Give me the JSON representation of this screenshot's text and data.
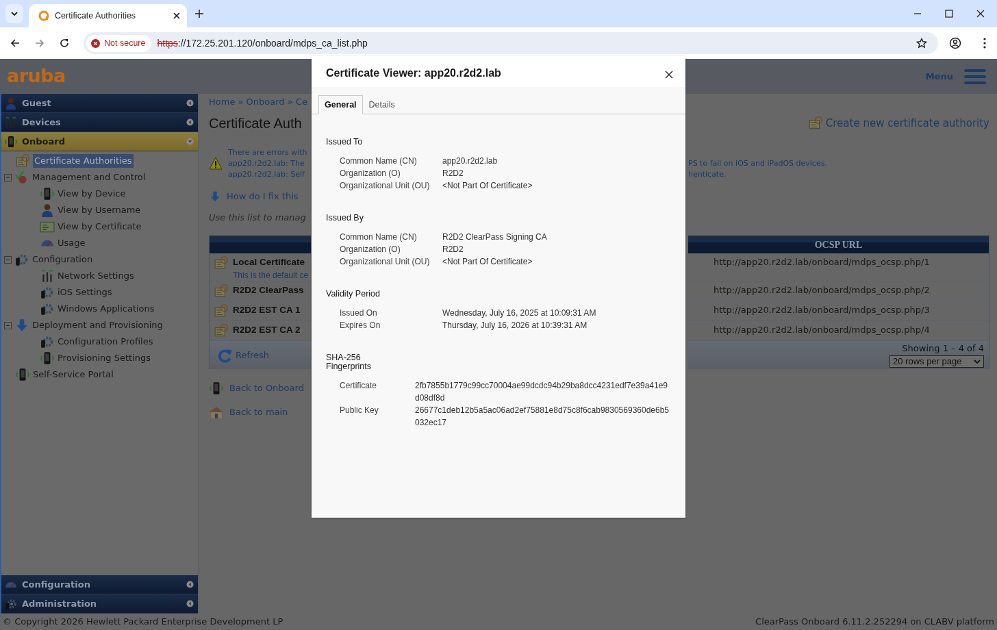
{
  "browser": {
    "tab_title": "Certificate Authorities",
    "security": "Not secure",
    "url_scheme": "https",
    "url_rest": "://172.25.201.120/onboard/mdps_ca_list.php"
  },
  "header": {
    "logo": "aruba",
    "menu_label": "Menu"
  },
  "sidebar": {
    "top_sections": [
      {
        "label": "Guest",
        "expanded": false
      },
      {
        "label": "Devices",
        "expanded": false
      },
      {
        "label": "Onboard",
        "expanded": true
      }
    ],
    "tree": [
      {
        "label": "Certificate Authorities",
        "selected": true
      },
      {
        "label": "Management and Control",
        "selected": false,
        "expanded": true,
        "children": [
          {
            "label": "View by Device",
            "selected": false
          },
          {
            "label": "View by Username",
            "selected": false
          },
          {
            "label": "View by Certificate",
            "selected": false
          },
          {
            "label": "Usage",
            "selected": false
          }
        ]
      },
      {
        "label": "Configuration",
        "selected": false,
        "expanded": true,
        "children": [
          {
            "label": "Network Settings",
            "selected": false
          },
          {
            "label": "iOS Settings",
            "selected": false
          },
          {
            "label": "Windows Applications",
            "selected": false
          }
        ]
      },
      {
        "label": "Deployment and Provisioning",
        "selected": false,
        "expanded": true,
        "children": [
          {
            "label": "Configuration Profiles",
            "selected": false
          },
          {
            "label": "Provisioning Settings",
            "selected": false
          }
        ]
      },
      {
        "label": "Self-Service Portal",
        "selected": false
      }
    ],
    "bottom_sections": [
      {
        "label": "Configuration",
        "expanded": false
      },
      {
        "label": "Administration",
        "expanded": false
      }
    ]
  },
  "content": {
    "breadcrumb": "Home » Onboard » Ce",
    "title": "Certificate Auth",
    "create_link": "Create new certificate authority",
    "warning_left": [
      "There are errors with",
      "app20.r2d2.lab: The",
      "app20.r2d2.lab: Self"
    ],
    "warning_right": [
      "PS to fail on iOS and iPadOS devices.",
      "henticate."
    ],
    "help_link": "How do I fix this",
    "intro": "Use this list to manag",
    "table": {
      "visible_column": "OCSP URL",
      "rows": [
        {
          "name": "Local Certificate",
          "note": "This is the default ce",
          "ocsp_url": "http://app20.r2d2.lab/onboard/mdps_ocsp.php/1"
        },
        {
          "name": "R2D2 ClearPass",
          "ocsp_url": "http://app20.r2d2.lab/onboard/mdps_ocsp.php/2"
        },
        {
          "name": "R2D2 EST CA 1",
          "ocsp_url": "http://app20.r2d2.lab/onboard/mdps_ocsp.php/3"
        },
        {
          "name": "R2D2 EST CA 2",
          "ocsp_url": "http://app20.r2d2.lab/onboard/mdps_ocsp.php/4"
        }
      ],
      "refresh": "Refresh",
      "showing": "Showing 1 – 4 of 4",
      "rows_per_page": "20 rows per page"
    },
    "links": [
      "Back to Onboard",
      "Back to main"
    ]
  },
  "footer": {
    "copyright": "© Copyright 2026 Hewlett Packard Enterprise Development LP",
    "version": "ClearPass Onboard 6.11.2.252294 on CLABV platform"
  },
  "dialog": {
    "title": "Certificate Viewer: app20.r2d2.lab",
    "tabs": [
      {
        "label": "General",
        "selected": true
      },
      {
        "label": "Details",
        "selected": false
      }
    ],
    "sections": [
      {
        "heading": "Issued To",
        "kind": "fields",
        "fields": [
          {
            "label": "Common Name (CN)",
            "value": "app20.r2d2.lab"
          },
          {
            "label": "Organization (O)",
            "value": "R2D2"
          },
          {
            "label": "Organizational Unit (OU)",
            "value": "<Not Part Of Certificate>"
          }
        ]
      },
      {
        "heading": "Issued By",
        "kind": "fields",
        "fields": [
          {
            "label": "Common Name (CN)",
            "value": "R2D2 ClearPass Signing CA"
          },
          {
            "label": "Organization (O)",
            "value": "R2D2"
          },
          {
            "label": "Organizational Unit (OU)",
            "value": "<Not Part Of Certificate>"
          }
        ]
      },
      {
        "heading": "Validity Period",
        "kind": "fields",
        "fields": [
          {
            "label": "Issued On",
            "value": "Wednesday, July 16, 2025 at 10:09:31 AM"
          },
          {
            "label": "Expires On",
            "value": "Thursday, July 16, 2026 at 10:39:31 AM"
          }
        ]
      },
      {
        "heading": "SHA-256 Fingerprints",
        "kind": "hashes",
        "fields": [
          {
            "label": "Certificate",
            "value": "2fb7855b1779c99cc70004ae99dcdc94b29ba8dcc4231edf7e39a41e9d08df8d"
          },
          {
            "label": "Public Key",
            "value": "26677c1deb12b5a5ac06ad2ef75881e8d75c8f6cab9830569360de6b5032ec17"
          }
        ]
      }
    ]
  }
}
